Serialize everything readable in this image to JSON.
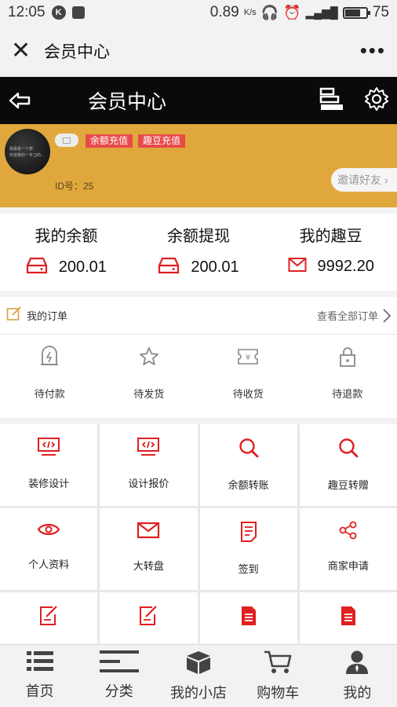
{
  "status_bar": {
    "time": "12:05",
    "net_speed": "0.89",
    "net_unit": "K/s",
    "battery": "75",
    "battery_level": 0.75
  },
  "webview": {
    "title": "会员中心",
    "more": "•••"
  },
  "header": {
    "title": "会员中心"
  },
  "profile": {
    "avatar_text_1": "我最看一个梦,",
    "avatar_text_2": "你说我的一手卫的…",
    "recharge_balance": "余额充值",
    "recharge_beans": "趣豆充值",
    "user_id": "ID号：25",
    "invite": "邀请好友"
  },
  "balances": [
    {
      "label": "我的余额",
      "value": "200.01",
      "icon": "wallet-icon"
    },
    {
      "label": "余额提现",
      "value": "200.01",
      "icon": "wallet-icon"
    },
    {
      "label": "我的趣豆",
      "value": "9992.20",
      "icon": "envelope-icon"
    }
  ],
  "orders": {
    "title": "我的订单",
    "view_all": "查看全部订单",
    "items": [
      {
        "label": "待付款",
        "icon": "pay-icon"
      },
      {
        "label": "待发货",
        "icon": "star-icon"
      },
      {
        "label": "待收货",
        "icon": "ticket-icon"
      },
      {
        "label": "待退款",
        "icon": "lock-icon"
      }
    ]
  },
  "menu": [
    {
      "label": "装修设计",
      "icon": "code-monitor-icon"
    },
    {
      "label": "设计报价",
      "icon": "code-monitor-icon"
    },
    {
      "label": "余额转账",
      "icon": "search-icon"
    },
    {
      "label": "趣豆转赠",
      "icon": "search-icon"
    },
    {
      "label": "个人资料",
      "icon": "eye-icon"
    },
    {
      "label": "大转盘",
      "icon": "envelope-icon"
    },
    {
      "label": "签到",
      "icon": "document-icon"
    },
    {
      "label": "商家申请",
      "icon": "share-icon"
    },
    {
      "label": "",
      "icon": "edit-icon"
    },
    {
      "label": "",
      "icon": "edit-icon"
    },
    {
      "label": "",
      "icon": "file-icon"
    },
    {
      "label": "",
      "icon": "file-icon"
    }
  ],
  "nav": [
    {
      "label": "首页",
      "icon": "list-icon"
    },
    {
      "label": "分类",
      "icon": "menu-lines-icon"
    },
    {
      "label": "我的小店",
      "icon": "box-icon"
    },
    {
      "label": "购物车",
      "icon": "cart-icon"
    },
    {
      "label": "我的",
      "icon": "user-icon"
    }
  ],
  "colors": {
    "accent": "#e02020",
    "profile_bg": "#e0a83c",
    "header_bg": "#0a0a0a",
    "tag_bg": "#e84a4a"
  }
}
